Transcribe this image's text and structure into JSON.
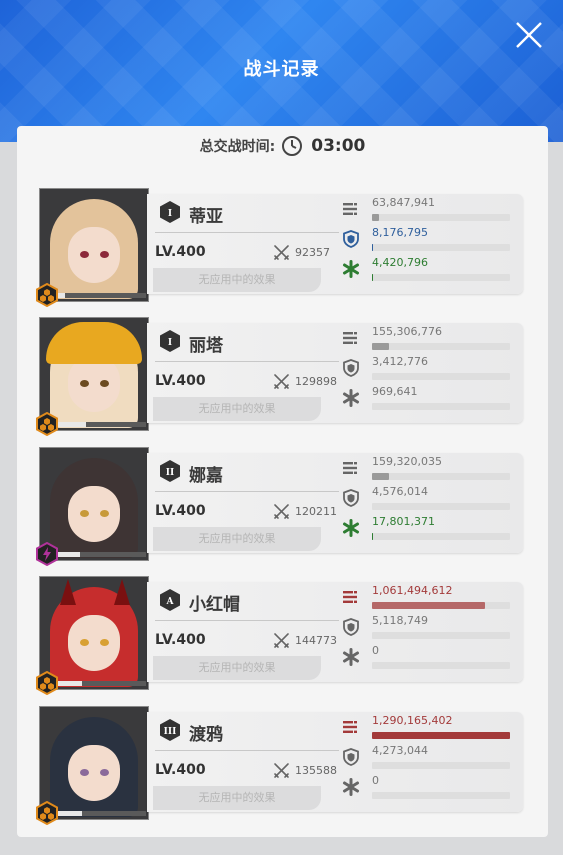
{
  "header": {
    "title": "战斗记录"
  },
  "battle_time": {
    "label": "总交战时间:",
    "value": "03:00"
  },
  "effect_label": "无应用中的效果",
  "colors": {
    "damage_high": "#a33a3a",
    "shield_blue": "#2f5f9c",
    "heal_green": "#2e7d32",
    "neutral": "#9a9a9a"
  },
  "characters": [
    {
      "name": "蒂亚",
      "rank": "I",
      "level": "LV.400",
      "power": "92357",
      "class_icon": "hex-burst-icon",
      "class_color": "#e08a1b",
      "hp_fraction": 0.12,
      "portrait": {
        "hair": "#e3c39b",
        "eye": "#8c2a3a",
        "accent": "helmet-none"
      },
      "stats": [
        {
          "kind": "damage",
          "value": "63,847,941",
          "fraction": 0.05,
          "color": "#9a9a9a",
          "text_color": "#777777"
        },
        {
          "kind": "shield",
          "value": "8,176,795",
          "fraction": 0.01,
          "color": "#2f5f9c",
          "text_color": "#2f5f9c"
        },
        {
          "kind": "heal",
          "value": "4,420,796",
          "fraction": 0.01,
          "color": "#2e7d32",
          "text_color": "#2e7d32"
        }
      ]
    },
    {
      "name": "丽塔",
      "rank": "I",
      "level": "LV.400",
      "power": "129898",
      "class_icon": "hex-burst-icon",
      "class_color": "#e08a1b",
      "hp_fraction": 0.35,
      "portrait": {
        "hair": "#f0dcc0",
        "eye": "#6b4a1f",
        "accent": "helmet"
      },
      "stats": [
        {
          "kind": "damage",
          "value": "155,306,776",
          "fraction": 0.12,
          "color": "#9a9a9a",
          "text_color": "#777777"
        },
        {
          "kind": "shield",
          "value": "3,412,776",
          "fraction": 0.0,
          "color": "#9a9a9a",
          "text_color": "#777777"
        },
        {
          "kind": "heal",
          "value": "969,641",
          "fraction": 0.0,
          "color": "#9a9a9a",
          "text_color": "#777777"
        }
      ]
    },
    {
      "name": "娜嘉",
      "rank": "II",
      "level": "LV.400",
      "power": "120211",
      "class_icon": "hex-lightning-icon",
      "class_color": "#b0329a",
      "hp_fraction": 0.28,
      "portrait": {
        "hair": "#3e3434",
        "eye": "#c79a3a",
        "accent": "none"
      },
      "stats": [
        {
          "kind": "damage",
          "value": "159,320,035",
          "fraction": 0.12,
          "color": "#9a9a9a",
          "text_color": "#777777"
        },
        {
          "kind": "shield",
          "value": "4,576,014",
          "fraction": 0.0,
          "color": "#9a9a9a",
          "text_color": "#777777"
        },
        {
          "kind": "heal",
          "value": "17,801,371",
          "fraction": 0.01,
          "color": "#2e7d32",
          "text_color": "#2e7d32"
        }
      ]
    },
    {
      "name": "小红帽",
      "rank": "A",
      "level": "LV.400",
      "power": "144773",
      "class_icon": "hex-burst-icon",
      "class_color": "#e08a1b",
      "hp_fraction": 0.3,
      "portrait": {
        "hair": "#c62d2d",
        "eye": "#d8a032",
        "accent": "horns"
      },
      "stats": [
        {
          "kind": "damage",
          "value": "1,061,494,612",
          "fraction": 0.82,
          "color": "#b56868",
          "text_color": "#a33a3a"
        },
        {
          "kind": "shield",
          "value": "5,118,749",
          "fraction": 0.0,
          "color": "#9a9a9a",
          "text_color": "#777777"
        },
        {
          "kind": "heal",
          "value": "0",
          "fraction": 0.0,
          "color": "#9a9a9a",
          "text_color": "#777777"
        }
      ]
    },
    {
      "name": "渡鸦",
      "rank": "III",
      "level": "LV.400",
      "power": "135588",
      "class_icon": "hex-burst-icon",
      "class_color": "#e08a1b",
      "hp_fraction": 0.3,
      "portrait": {
        "hair": "#2a3240",
        "eye": "#8a6a9a",
        "accent": "none"
      },
      "stats": [
        {
          "kind": "damage",
          "value": "1,290,165,402",
          "fraction": 1.0,
          "color": "#a33a3a",
          "text_color": "#a33a3a"
        },
        {
          "kind": "shield",
          "value": "4,273,044",
          "fraction": 0.0,
          "color": "#9a9a9a",
          "text_color": "#777777"
        },
        {
          "kind": "heal",
          "value": "0",
          "fraction": 0.0,
          "color": "#9a9a9a",
          "text_color": "#777777"
        }
      ]
    }
  ]
}
